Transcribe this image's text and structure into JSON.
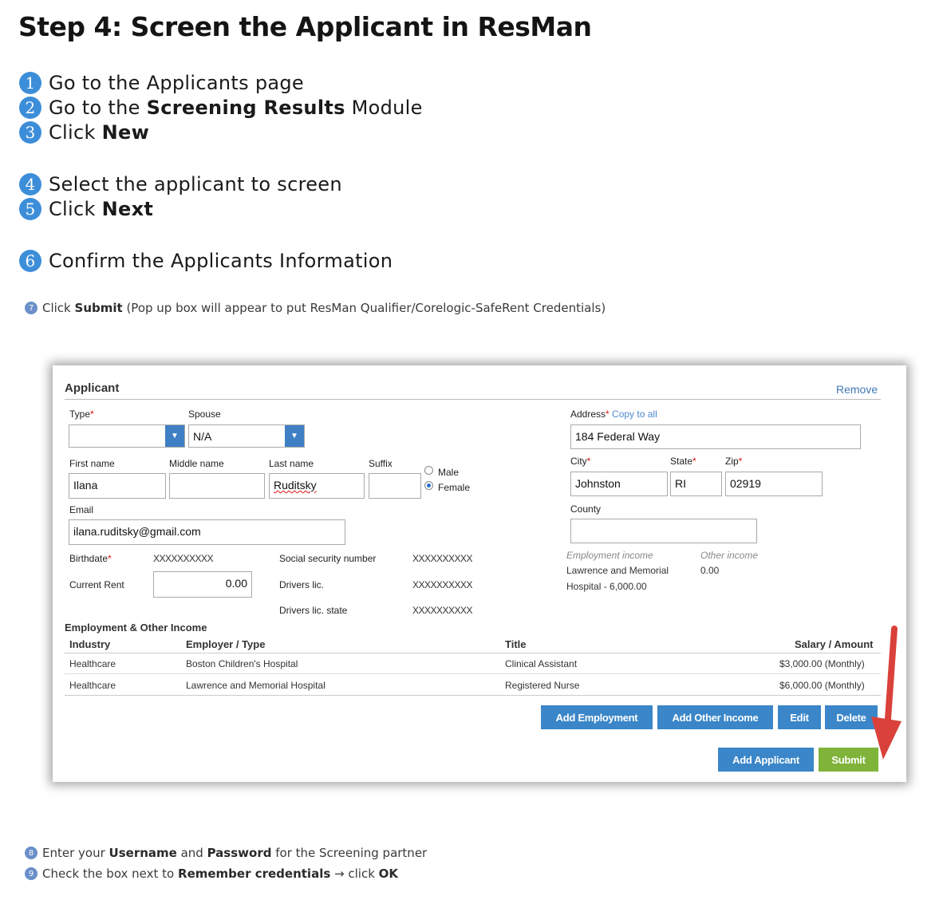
{
  "title": "Step 4: Screen the Applicant in ResMan",
  "steps": [
    {
      "num": "1",
      "pre": "Go to the Applicants page",
      "bold": "",
      "post": ""
    },
    {
      "num": "2",
      "pre": "Go to the ",
      "bold": "Screening Results",
      "post": " Module"
    },
    {
      "num": "3",
      "pre": "Click ",
      "bold": "New",
      "post": ""
    },
    {
      "num": "4",
      "pre": "Select the applicant to screen",
      "bold": "",
      "post": ""
    },
    {
      "num": "5",
      "pre": "Click ",
      "bold": "Next",
      "post": ""
    },
    {
      "num": "6",
      "pre": "Confirm the Applicants Information",
      "bold": "",
      "post": ""
    }
  ],
  "small_steps": [
    {
      "num": "7",
      "pre": "Click ",
      "bold": "Submit",
      "mid": " (Pop up box will appear to put ResMan Qualifier/Corelogic-SafeRent Credentials)",
      "bold2": "",
      "post": ""
    },
    {
      "num": "8",
      "pre": "Enter your ",
      "bold": "Username",
      "mid": " and ",
      "bold2": "Password",
      "post": " for the Screening partner"
    },
    {
      "num": "9",
      "pre": "Check the box next to ",
      "bold": "Remember credentials",
      "mid": " → click ",
      "bold2": "OK",
      "post": ""
    }
  ],
  "form": {
    "heading": "Applicant",
    "remove": "Remove",
    "type_label": "Type",
    "type_value": "",
    "spouse_label": "Spouse",
    "spouse_value": "N/A",
    "first_label": "First name",
    "first_value": "Ilana",
    "middle_label": "Middle name",
    "middle_value": "",
    "last_label": "Last name",
    "last_value": "Ruditsky",
    "suffix_label": "Suffix",
    "suffix_value": "",
    "male": "Male",
    "female": "Female",
    "email_label": "Email",
    "email_value": "ilana.ruditsky@gmail.com",
    "birthdate_label": "Birthdate",
    "birthdate_value": "XXXXXXXXXX",
    "rent_label": "Current Rent",
    "rent_value": "0.00",
    "ssn_label": "Social security number",
    "ssn_value": "XXXXXXXXXX",
    "dl_label": "Drivers lic.",
    "dl_value": "XXXXXXXXXX",
    "dl_state_label": "Drivers lic. state",
    "dl_state_value": "XXXXXXXXXX",
    "address_label": "Address",
    "copy_all": "Copy to all",
    "address_value": "184 Federal Way",
    "city_label": "City",
    "city_value": "Johnston",
    "state_label": "State",
    "state_value": "RI",
    "zip_label": "Zip",
    "zip_value": "02919",
    "county_label": "County",
    "county_value": "",
    "emp_income_label": "Employment income",
    "emp_income_value_1": "Lawrence and Memorial",
    "emp_income_value_2": "Hospital - 6,000.00",
    "other_income_label": "Other income",
    "other_income_value": "0.00"
  },
  "employment": {
    "heading": "Employment & Other Income",
    "columns": [
      "Industry",
      "Employer / Type",
      "Title",
      "Salary / Amount"
    ],
    "rows": [
      [
        "Healthcare",
        "Boston Children's Hospital",
        "Clinical Assistant",
        "$3,000.00 (Monthly)"
      ],
      [
        "Healthcare",
        "Lawrence and Memorial Hospital",
        "Registered Nurse",
        "$6,000.00 (Monthly)"
      ]
    ]
  },
  "buttons": {
    "add_employment": "Add Employment",
    "add_other_income": "Add Other Income",
    "edit": "Edit",
    "delete": "Delete",
    "add_applicant": "Add Applicant",
    "submit": "Submit"
  },
  "colors": {
    "step_circle": "#3d8ed9",
    "button_blue": "#3a86c8",
    "button_green": "#7fb339",
    "arrow_red": "#d9413a",
    "link_blue": "#4178b5"
  }
}
